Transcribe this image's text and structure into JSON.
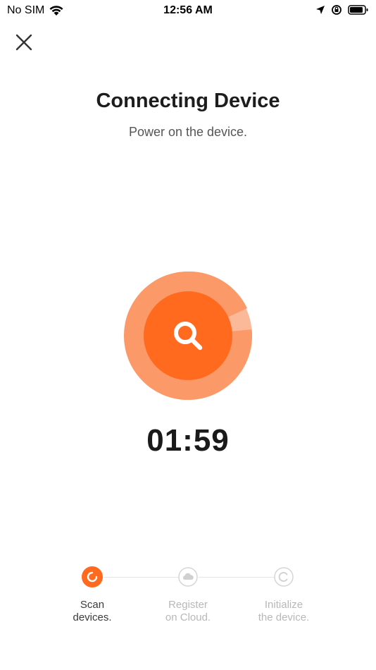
{
  "status_bar": {
    "carrier": "No SIM",
    "time": "12:56 AM"
  },
  "header": {
    "close_icon": "close-icon"
  },
  "main": {
    "title": "Connecting Device",
    "subtitle": "Power on the device.",
    "timer": "01:59",
    "scan_icon": "search-icon"
  },
  "colors": {
    "accent": "#ff6a1f",
    "ring_outer": "#fbb99a",
    "ring_progress": "#fb8e54",
    "inactive": "#c9c9c9"
  },
  "steps": [
    {
      "line1": "Scan",
      "line2": "devices.",
      "icon": "loading-icon",
      "state": "active"
    },
    {
      "line1": "Register",
      "line2": "on Cloud.",
      "icon": "cloud-icon",
      "state": "inactive"
    },
    {
      "line1": "Initialize",
      "line2": "the device.",
      "icon": "initialize-icon",
      "state": "inactive"
    }
  ]
}
